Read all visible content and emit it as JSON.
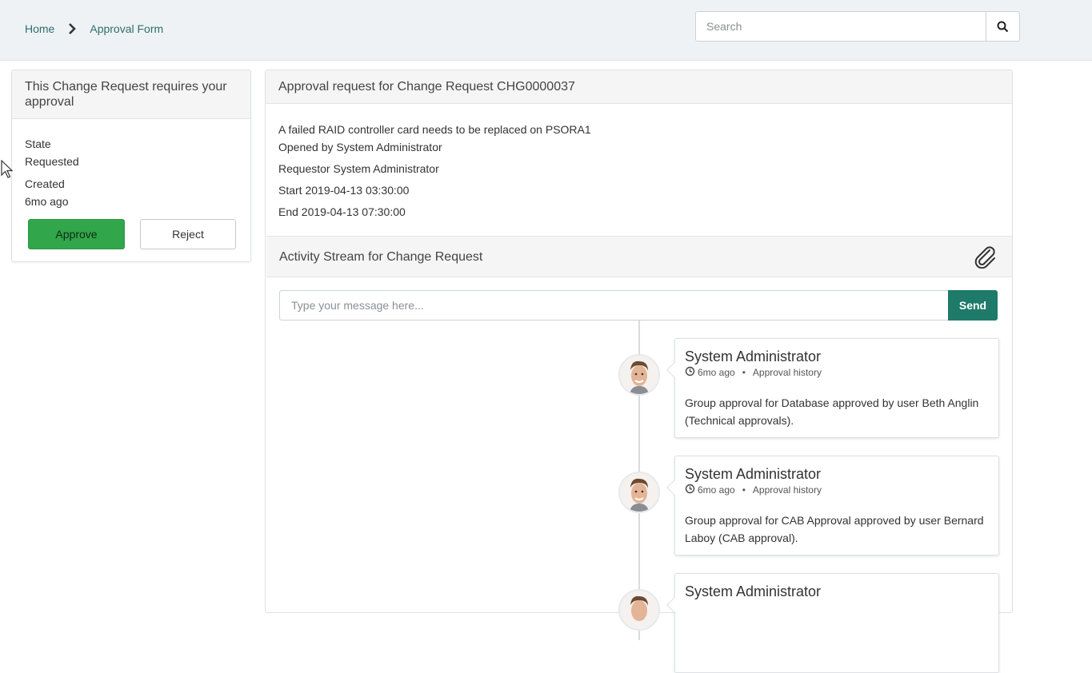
{
  "breadcrumb": {
    "home": "Home",
    "current": "Approval Form"
  },
  "search": {
    "placeholder": "Search"
  },
  "approval_panel": {
    "title": "This Change Request requires your approval",
    "state_label": "State",
    "state_value": "Requested",
    "created_label": "Created",
    "created_value": "6mo ago",
    "approve_label": "Approve",
    "reject_label": "Reject"
  },
  "request": {
    "title": "Approval request for Change Request CHG0000037",
    "short_description": "A failed RAID controller card needs to be replaced on PSORA1",
    "opened_by": "Opened by System Administrator",
    "requestor": "Requestor System Administrator",
    "start": "Start 2019-04-13 03:30:00",
    "end": "End 2019-04-13 07:30:00"
  },
  "activity": {
    "title": "Activity Stream for Change Request",
    "message_placeholder": "Type your message here...",
    "send_label": "Send",
    "entries": [
      {
        "author": "System Administrator",
        "time": "6mo ago",
        "source": "Approval history",
        "text": "Group approval for Database approved by user Beth Anglin (Technical approvals)."
      },
      {
        "author": "System Administrator",
        "time": "6mo ago",
        "source": "Approval history",
        "text": "Group approval for CAB Approval approved by user Bernard Laboy (CAB approval)."
      },
      {
        "author": "System Administrator",
        "time": "",
        "source": "",
        "text": ""
      }
    ]
  },
  "colors": {
    "approve": "#31a64a",
    "send": "#1e7a69",
    "link": "#2f6e6a",
    "topbar": "#eef2f5"
  },
  "icons": [
    "chevron-right-icon",
    "search-icon",
    "paperclip-icon",
    "clock-icon",
    "avatar"
  ]
}
